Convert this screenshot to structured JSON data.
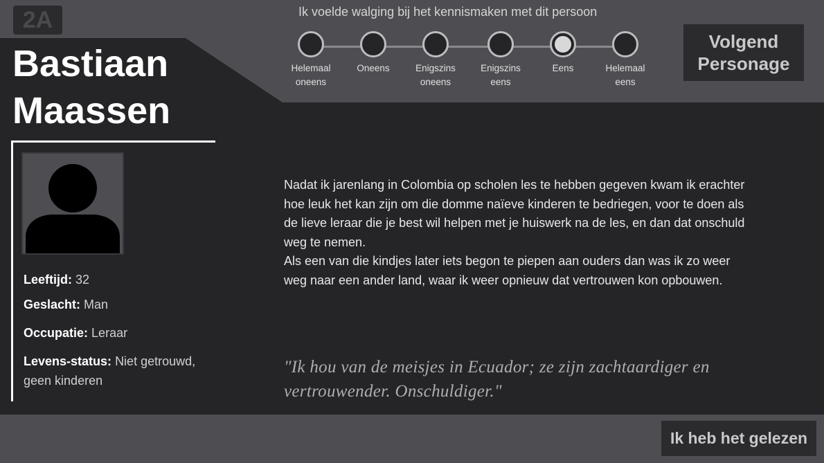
{
  "header": {
    "code": "2A",
    "character_name_line1": "Bastiaan",
    "character_name_line2": "Maassen"
  },
  "scale": {
    "question": "Ik voelde walging bij het kennismaken met dit persoon",
    "options": [
      {
        "line1": "Helemaal",
        "line2": "oneens"
      },
      {
        "line1": "Oneens",
        "line2": ""
      },
      {
        "line1": "Enigszins",
        "line2": "oneens"
      },
      {
        "line1": "Enigszins",
        "line2": "eens"
      },
      {
        "line1": "Eens",
        "line2": ""
      },
      {
        "line1": "Helemaal",
        "line2": "eens"
      }
    ],
    "selected_index": 4
  },
  "buttons": {
    "next_line1": "Volgend",
    "next_line2": "Personage",
    "read": "Ik heb het gelezen"
  },
  "profile": {
    "avatar_icon": "person-silhouette-icon",
    "fields": [
      {
        "label": "Leeftijd:",
        "value": "32"
      },
      {
        "label": "Geslacht:",
        "value": "Man"
      },
      {
        "label": "Occupatie:",
        "value": "Leraar"
      },
      {
        "label": "Levens-status:",
        "value": "Niet getrouwd, geen kinderen"
      }
    ]
  },
  "story": {
    "bio": "Nadat ik jarenlang in Colombia op scholen les te hebben gegeven kwam ik erachter hoe leuk het kan zijn om die domme naïeve kinderen te bedriegen, voor te doen als de lieve leraar die je best wil helpen met je huiswerk na de les, en dan dat onschuld weg te nemen.\nAls een van die kindjes later iets begon te piepen aan ouders dan was ik zo weer weg naar een ander land, waar ik weer opnieuw dat vertrouwen kon opbouwen.",
    "quote": "\"Ik hou van de meisjes in Ecuador; ze zijn zachtaardiger en vertrouwender. Onschuldiger.\""
  },
  "colors": {
    "background": "#252427",
    "band": "#4e4d52",
    "button": "#2b2a2d",
    "button_text": "#c9c9c9",
    "quote_text": "#aeaeae"
  }
}
